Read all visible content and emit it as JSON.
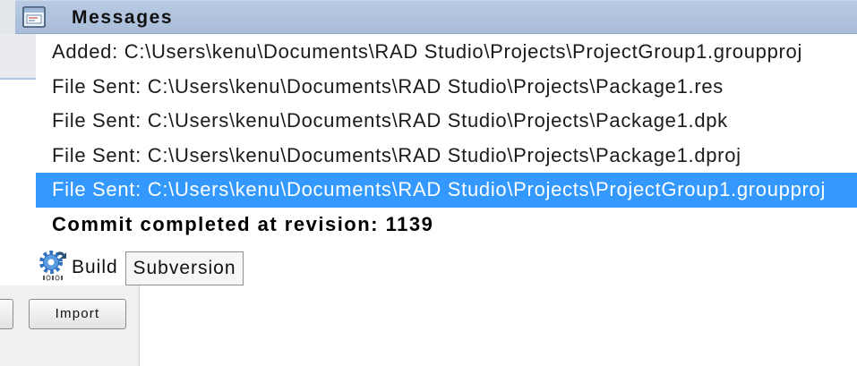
{
  "header": {
    "title": "Messages",
    "icon": "messages-window-icon"
  },
  "messages": [
    {
      "text": "Added: C:\\Users\\kenu\\Documents\\RAD Studio\\Projects\\ProjectGroup1.groupproj"
    },
    {
      "text": "File Sent: C:\\Users\\kenu\\Documents\\RAD Studio\\Projects\\Package1.res"
    },
    {
      "text": "File Sent: C:\\Users\\kenu\\Documents\\RAD Studio\\Projects\\Package1.dpk"
    },
    {
      "text": "File Sent: C:\\Users\\kenu\\Documents\\RAD Studio\\Projects\\Package1.dproj"
    },
    {
      "text": "File Sent: C:\\Users\\kenu\\Documents\\RAD Studio\\Projects\\ProjectGroup1.groupproj",
      "selected": true
    },
    {
      "text": "Commit completed at revision: 1139",
      "bold": true
    }
  ],
  "tabs": [
    {
      "label": "Build",
      "icon": "build-gear-icon",
      "active": true
    },
    {
      "label": "Subversion",
      "active": false
    }
  ],
  "toolbar": {
    "import_label": "Import"
  },
  "colors": {
    "header_bg": "#a9bdd9",
    "selection_bg": "#3399ff",
    "selection_text": "#ffffff"
  }
}
